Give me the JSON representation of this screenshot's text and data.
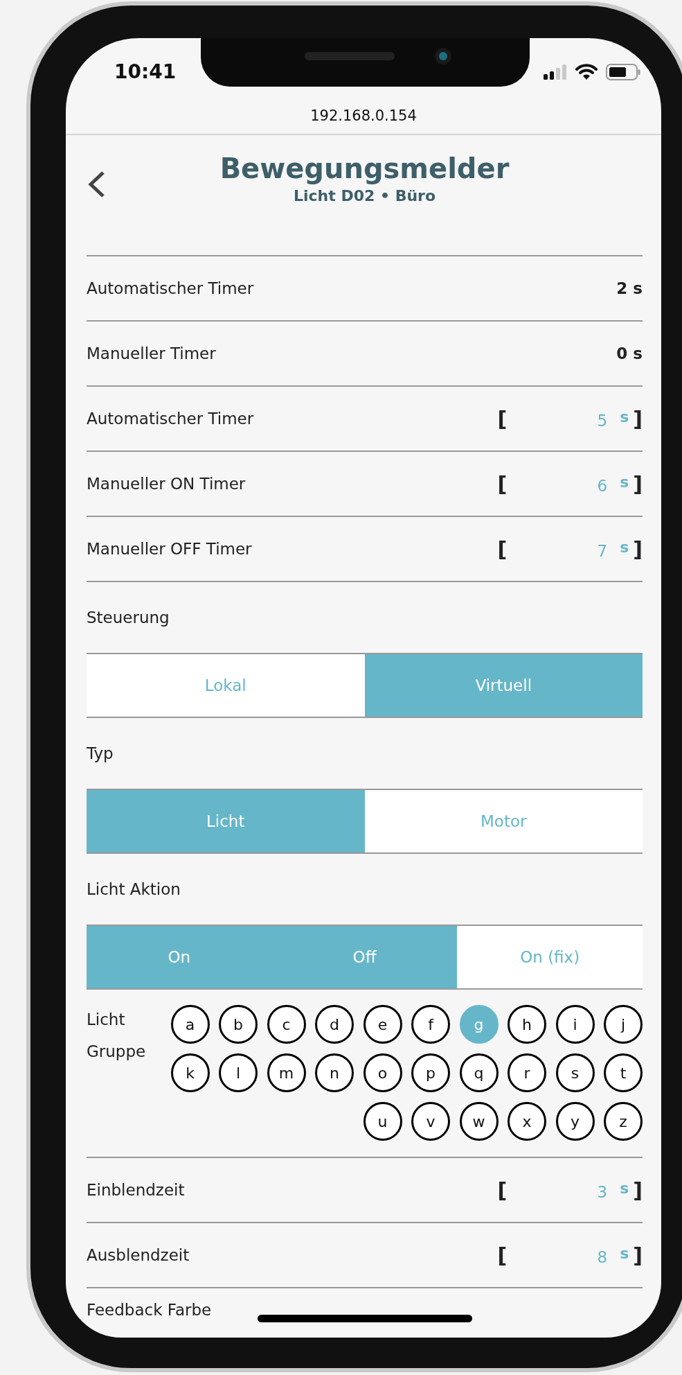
{
  "status_bar": {
    "time": "10:41"
  },
  "address_bar": {
    "url": "192.168.0.154"
  },
  "header": {
    "title": "Bewegungsmelder",
    "subtitle": "Licht D02 • Büro"
  },
  "settings": [
    {
      "kind": "readonly",
      "label": "Automatischer Timer",
      "value": "2 s"
    },
    {
      "kind": "readonly",
      "label": "Manueller Timer",
      "value": "0 s"
    },
    {
      "kind": "input",
      "label": "Automatischer Timer",
      "bracket_open": "[",
      "value": "5",
      "unit": "s",
      "bracket_close": "]"
    },
    {
      "kind": "input",
      "label": "Manueller ON Timer",
      "bracket_open": "[",
      "value": "6",
      "unit": "s",
      "bracket_close": "]"
    },
    {
      "kind": "input",
      "label": "Manueller OFF Timer",
      "bracket_open": "[",
      "value": "7",
      "unit": "s",
      "bracket_close": "]"
    },
    {
      "kind": "heading",
      "label": "Steuerung"
    },
    {
      "kind": "segmented",
      "options": [
        {
          "label": "Lokal",
          "selected": false
        },
        {
          "label": "Virtuell",
          "selected": true
        }
      ]
    },
    {
      "kind": "heading",
      "label": "Typ"
    },
    {
      "kind": "segmented",
      "options": [
        {
          "label": "Licht",
          "selected": true
        },
        {
          "label": "Motor",
          "selected": false
        }
      ]
    },
    {
      "kind": "heading",
      "label": "Licht Aktion"
    },
    {
      "kind": "segmented",
      "options": [
        {
          "label": "On",
          "selected": true
        },
        {
          "label": "Off",
          "selected": true
        },
        {
          "label": "On (fix)",
          "selected": false
        }
      ]
    },
    {
      "kind": "letters",
      "label": "Licht Gruppe",
      "options": [
        {
          "label": "a",
          "selected": false
        },
        {
          "label": "b",
          "selected": false
        },
        {
          "label": "c",
          "selected": false
        },
        {
          "label": "d",
          "selected": false
        },
        {
          "label": "e",
          "selected": false
        },
        {
          "label": "f",
          "selected": false
        },
        {
          "label": "g",
          "selected": true
        },
        {
          "label": "h",
          "selected": false
        },
        {
          "label": "i",
          "selected": false
        },
        {
          "label": "j",
          "selected": false
        },
        {
          "label": "k",
          "selected": false
        },
        {
          "label": "l",
          "selected": false
        },
        {
          "label": "m",
          "selected": false
        },
        {
          "label": "n",
          "selected": false
        },
        {
          "label": "o",
          "selected": false
        },
        {
          "label": "p",
          "selected": false
        },
        {
          "label": "q",
          "selected": false
        },
        {
          "label": "r",
          "selected": false
        },
        {
          "label": "s",
          "selected": false
        },
        {
          "label": "t",
          "selected": false
        },
        {
          "label": "u",
          "selected": false
        },
        {
          "label": "v",
          "selected": false
        },
        {
          "label": "w",
          "selected": false
        },
        {
          "label": "x",
          "selected": false
        },
        {
          "label": "y",
          "selected": false
        },
        {
          "label": "z",
          "selected": false
        }
      ]
    },
    {
      "kind": "input",
      "label": "Einblendzeit",
      "bracket_open": "[",
      "value": "3",
      "unit": "s",
      "bracket_close": "]"
    },
    {
      "kind": "input",
      "label": "Ausblendzeit",
      "bracket_open": "[",
      "value": "8",
      "unit": "s",
      "bracket_close": "]"
    },
    {
      "kind": "heading",
      "label": "Feedback Farbe"
    }
  ]
}
